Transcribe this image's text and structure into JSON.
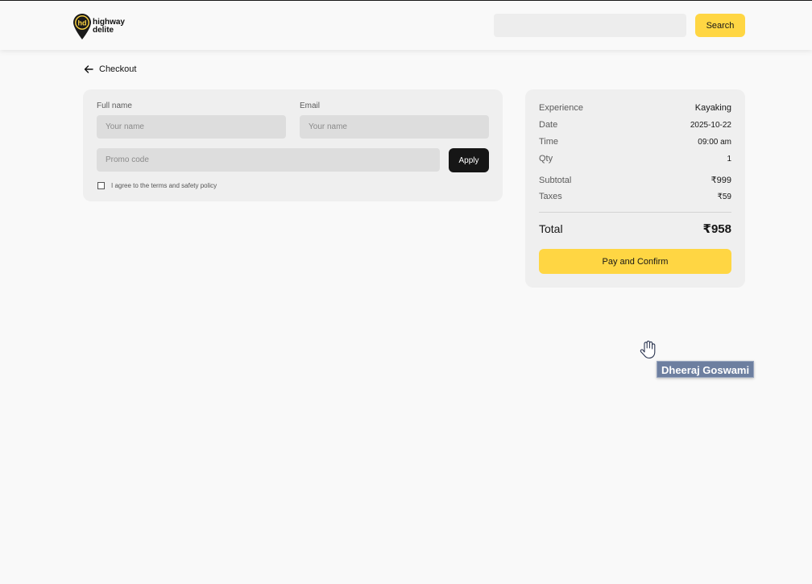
{
  "header": {
    "logo_text_line1": "highway",
    "logo_text_line2": "delite",
    "logo_mark": "hd",
    "search_value": "",
    "search_button_label": "Search"
  },
  "checkout": {
    "back_label": "Checkout"
  },
  "form": {
    "full_name_label": "Full name",
    "full_name_placeholder": "Your name",
    "email_label": "Email",
    "email_placeholder": "Your name",
    "promo_placeholder": "Promo code",
    "apply_label": "Apply",
    "terms_label": "I agree to the terms and safety policy",
    "terms_checked": false
  },
  "summary": {
    "experience_label": "Experience",
    "experience_value": "Kayaking",
    "date_label": "Date",
    "date_value": "2025-10-22",
    "time_label": "Time",
    "time_value": "09:00 am",
    "qty_label": "Qty",
    "qty_value": "1",
    "subtotal_label": "Subtotal",
    "subtotal_value": "₹999",
    "taxes_label": "Taxes",
    "taxes_value": "₹59",
    "total_label": "Total",
    "total_value": "₹958",
    "pay_label": "Pay and Confirm"
  },
  "overlay": {
    "user_name": "Dheeraj Goswami",
    "cursor_icon": "hand-pointer-icon"
  },
  "colors": {
    "accent": "#ffd643",
    "dark": "#161616",
    "card_bg": "#efefef",
    "page_bg": "#f9f9f9"
  }
}
